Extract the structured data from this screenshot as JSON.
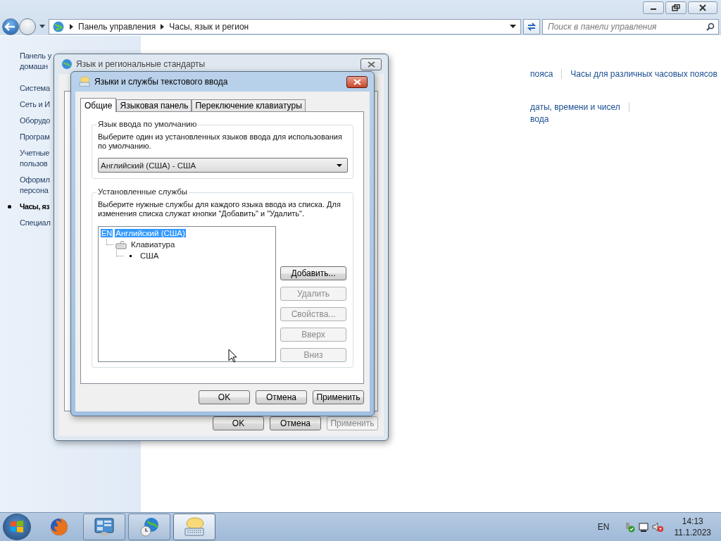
{
  "address_bar": {
    "breadcrumbs": [
      "Панель управления",
      "Часы, язык и регион"
    ],
    "search": {
      "placeholder": "Поиск в панели управления"
    }
  },
  "sidebar": {
    "items": [
      {
        "lines": [
          "Панель у",
          "домашн"
        ],
        "selected": false
      },
      {
        "lines": [
          "Система"
        ],
        "selected": false
      },
      {
        "lines": [
          "Сеть и И"
        ],
        "selected": false
      },
      {
        "lines": [
          "Оборудо"
        ],
        "selected": false
      },
      {
        "lines": [
          "Програм"
        ],
        "selected": false
      },
      {
        "lines": [
          "Учетные",
          "пользов"
        ],
        "selected": false
      },
      {
        "lines": [
          "Оформл",
          "персона"
        ],
        "selected": false
      },
      {
        "lines": [
          "Часы, яз"
        ],
        "selected": true
      },
      {
        "lines": [
          "Специал"
        ],
        "selected": false
      }
    ]
  },
  "content_rows": [
    {
      "links": [
        "пояса",
        "Часы для различных часовых поясов"
      ],
      "trailing_separator": false
    },
    {
      "links": [
        "даты, времени и чисел"
      ],
      "trailing_separator": true
    },
    {
      "links": [
        "вода"
      ],
      "trailing_separator": false
    }
  ],
  "outer_dialog": {
    "title": "Язык и региональные стандарты",
    "buttons": [
      {
        "label": "OK",
        "disabled": false
      },
      {
        "label": "Отмена",
        "disabled": false
      },
      {
        "label": "Применить",
        "disabled": true
      }
    ]
  },
  "inner_dialog": {
    "title": "Языки и службы текстового ввода",
    "tabs": [
      {
        "label": "Общие",
        "selected": true
      },
      {
        "label": "Языковая панель",
        "selected": false
      },
      {
        "label": "Переключение клавиатуры",
        "selected": false
      }
    ],
    "default_language": {
      "legend": "Язык ввода по умолчанию",
      "description": "Выберите один из установленных языков ввода для использования по умолчанию.",
      "value": "Английский (США) - США"
    },
    "installed_services": {
      "legend": "Установленные службы",
      "description": "Выберите нужные службы для каждого языка ввода из списка. Для изменения списка служат кнопки \"Добавить\" и \"Удалить\".",
      "tree": [
        {
          "kind": "language",
          "badge": "EN",
          "label": "Английский (США)",
          "selected": true,
          "children": [
            {
              "kind": "category",
              "label": "Клавиатура",
              "selected": false,
              "children": [
                {
                  "kind": "layout",
                  "label": "США",
                  "selected": false
                }
              ]
            }
          ]
        }
      ]
    },
    "side_buttons": [
      {
        "label": "Добавить...",
        "disabled": false
      },
      {
        "label": "Удалить",
        "disabled": true
      },
      {
        "label": "Свойства...",
        "disabled": true
      },
      {
        "label": "Вверх",
        "disabled": true
      },
      {
        "label": "Вниз",
        "disabled": true
      }
    ],
    "buttons": [
      {
        "label": "OK",
        "disabled": false
      },
      {
        "label": "Отмена",
        "disabled": false
      },
      {
        "label": "Применить",
        "disabled": false
      }
    ]
  },
  "taskbar": {
    "apps": [
      {
        "kind": "firefox",
        "selected": false
      },
      {
        "kind": "control-panel",
        "selected": false
      },
      {
        "kind": "globe-clock",
        "selected": false
      },
      {
        "kind": "keyboard",
        "selected": true
      }
    ],
    "language": "EN",
    "time": "14:13",
    "date": "11.1.2023"
  }
}
